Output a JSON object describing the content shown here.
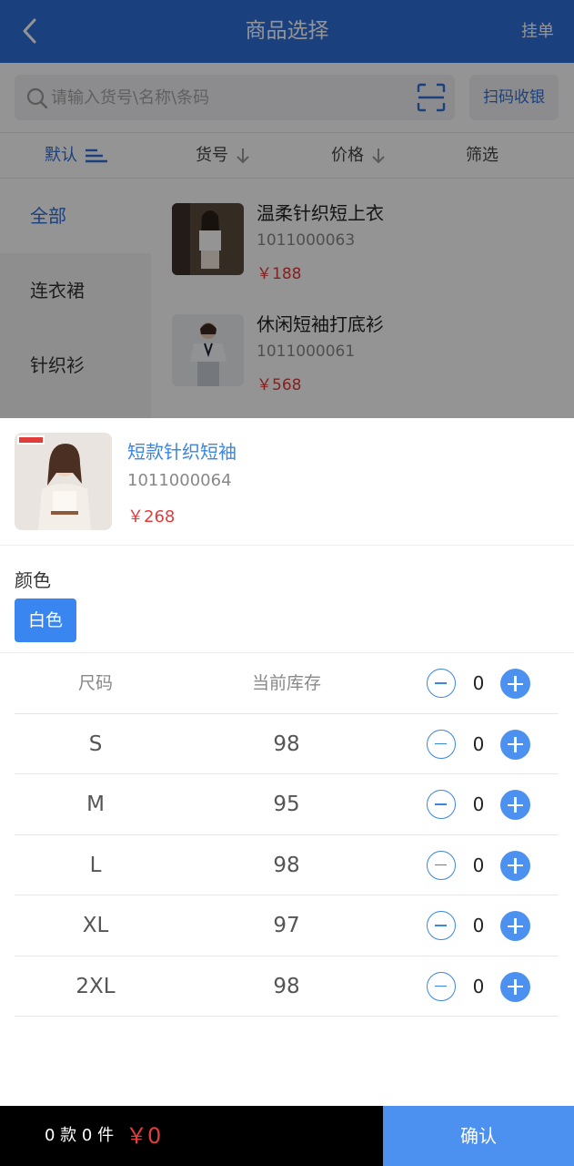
{
  "header": {
    "title": "商品选择",
    "hold_label": "挂单"
  },
  "search": {
    "placeholder": "请输入货号\\名称\\条码",
    "cashier_label": "扫码收银"
  },
  "sort": {
    "default_label": "默认",
    "code_label": "货号",
    "price_label": "价格",
    "filter_label": "筛选"
  },
  "categories": [
    "全部",
    "连衣裙",
    "针织衫"
  ],
  "products": [
    {
      "name": "温柔针织短上衣",
      "code": "1011000063",
      "price": "￥188"
    },
    {
      "name": "休闲短袖打底衫",
      "code": "1011000061",
      "price": "￥568"
    }
  ],
  "selected": {
    "name": "短款针织短袖",
    "code": "1011000064",
    "price": "￥268",
    "color_label": "颜色",
    "color": "白色"
  },
  "size_table": {
    "headers": {
      "size": "尺码",
      "stock": "当前库存",
      "qty": "0"
    },
    "rows": [
      {
        "size": "S",
        "stock": "98",
        "qty": "0"
      },
      {
        "size": "M",
        "stock": "95",
        "qty": "0"
      },
      {
        "size": "L",
        "stock": "98",
        "qty": "0"
      },
      {
        "size": "XL",
        "stock": "97",
        "qty": "0"
      },
      {
        "size": "2XL",
        "stock": "98",
        "qty": "0"
      }
    ]
  },
  "footer": {
    "summary": "0 款 0 件",
    "total": "￥0",
    "confirm_label": "确认"
  },
  "colors": {
    "primary": "#2f6fd9",
    "accent": "#4c90f0",
    "price_red": "#e03c3c"
  },
  "icons": {
    "back": "chevron-left-icon",
    "search": "search-icon",
    "scan": "scan-icon",
    "plus": "plus-icon",
    "minus": "minus-icon"
  }
}
